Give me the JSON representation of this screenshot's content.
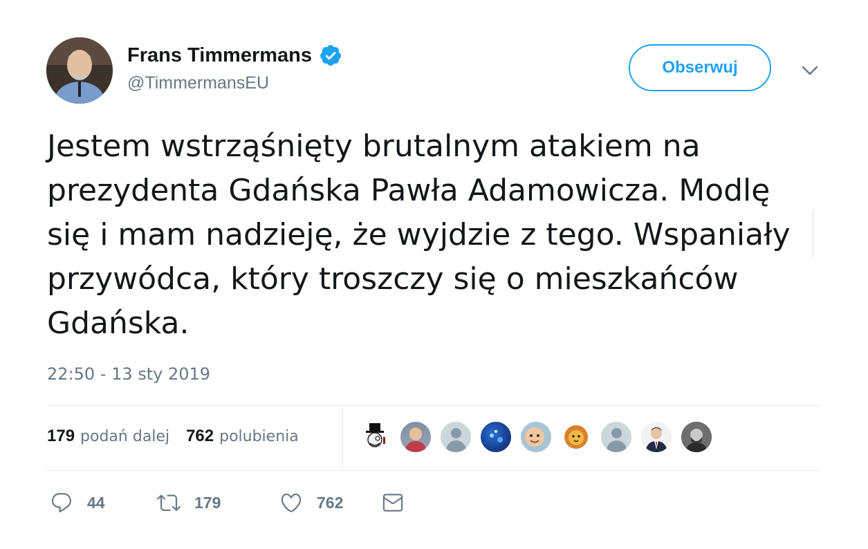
{
  "author": {
    "display_name": "Frans Timmermans",
    "handle": "@TimmermansEU",
    "verified_icon": "verified-badge-icon"
  },
  "follow_button": {
    "label": "Obserwuj"
  },
  "menu_icon": "chevron-down-icon",
  "tweet": {
    "text": "Jestem wstrząśnięty brutalnym atakiem na prezydenta Gdańska Pawła Adamowicza. Modlę się i mam nadzieję, że wyjdzie z tego. Wspaniały przywódca, który troszczy się o mieszkańców Gdańska.",
    "timestamp": "22:50 - 13 sty 2019"
  },
  "stats": {
    "retweets_count": "179",
    "retweets_label": "podań dalej",
    "likes_count": "762",
    "likes_label": "polubienia"
  },
  "likers_count_shown": 9,
  "actions": {
    "reply": {
      "icon": "reply-icon",
      "count": "44"
    },
    "retweet": {
      "icon": "retweet-icon",
      "count": "179"
    },
    "like": {
      "icon": "heart-icon",
      "count": "762"
    },
    "message": {
      "icon": "envelope-icon"
    }
  },
  "colors": {
    "accent": "#1da1f2",
    "text": "#14171a",
    "secondary": "#657786",
    "divider": "#e6ecf0"
  }
}
